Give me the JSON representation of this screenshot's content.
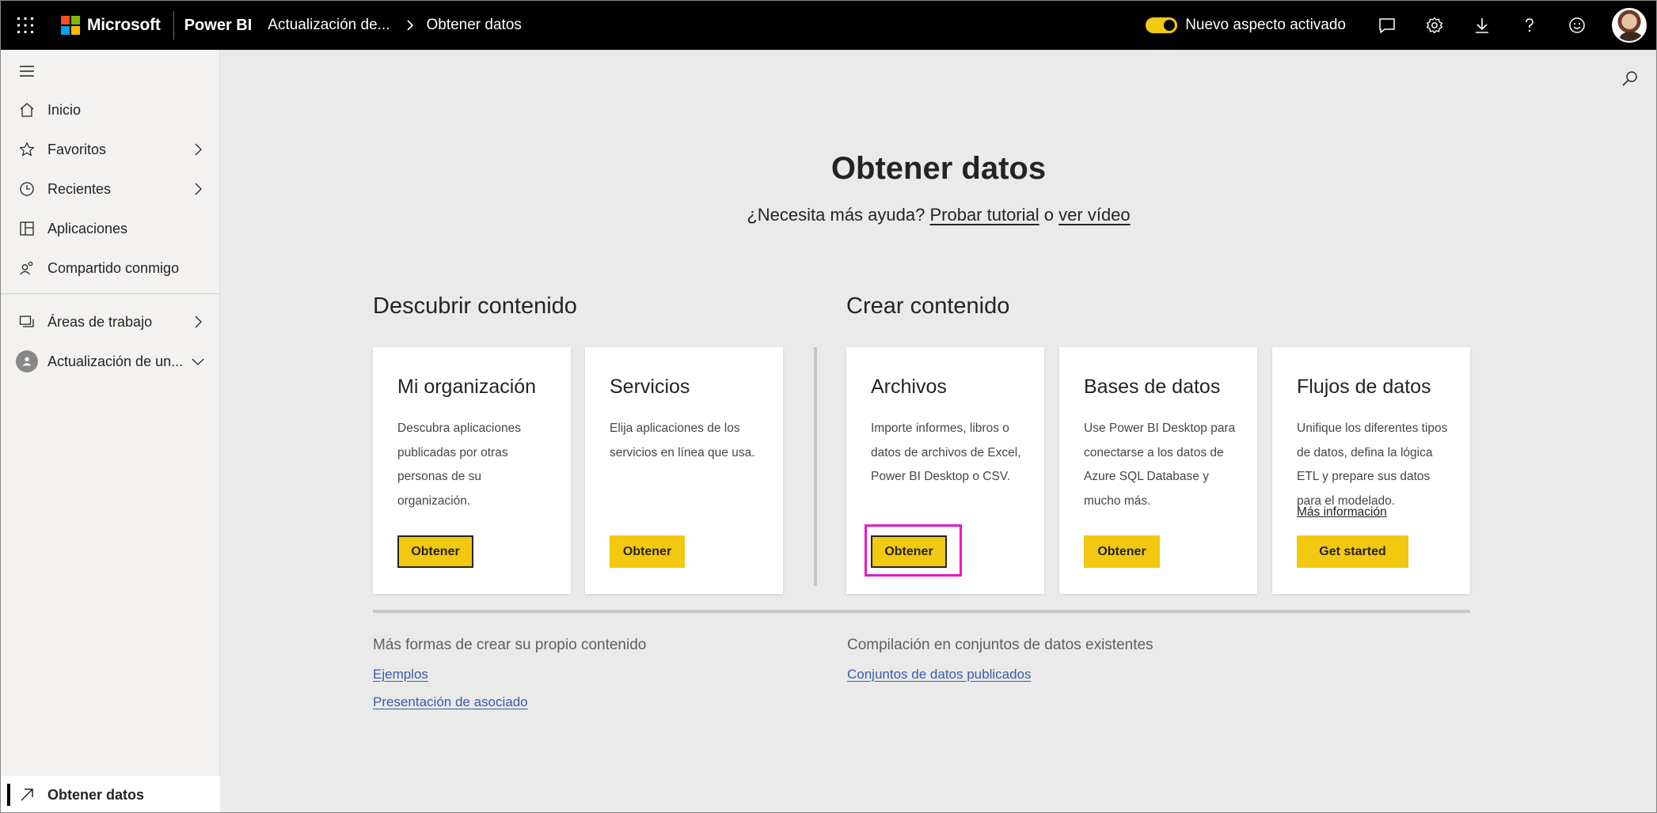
{
  "header": {
    "brand": "Microsoft",
    "product": "Power BI",
    "breadcrumb_workspace": "Actualización de...",
    "breadcrumb_page": "Obtener datos",
    "toggle_label": "Nuevo aspecto activado",
    "brand_colors": [
      "#f25022",
      "#7fba00",
      "#00a4ef",
      "#ffb900"
    ],
    "icons": [
      "waffle-icon",
      "feedback-icon",
      "settings-icon",
      "download-icon",
      "help-icon",
      "smiley-icon"
    ]
  },
  "sidebar": {
    "items": [
      {
        "label": "Inicio",
        "icon": "home-icon"
      },
      {
        "label": "Favoritos",
        "icon": "star-icon"
      },
      {
        "label": "Recientes",
        "icon": "clock-icon"
      },
      {
        "label": "Aplicaciones",
        "icon": "apps-icon"
      },
      {
        "label": "Compartido conmigo",
        "icon": "shared-icon"
      },
      {
        "label": "Áreas de trabajo",
        "icon": "workspaces-icon"
      },
      {
        "label": "Actualización de un...",
        "icon": "workspace-avatar-icon"
      }
    ],
    "bottom_item": "Obtener datos"
  },
  "main": {
    "title": "Obtener datos",
    "help_prefix": "¿Necesita más ayuda?",
    "help_link1": "Probar tutorial",
    "help_or": "o",
    "help_link2": "ver vídeo",
    "discover_heading": "Descubrir contenido",
    "create_heading": "Crear contenido",
    "cards": [
      {
        "title": "Mi organización",
        "description": "Descubra aplicaciones publicadas por otras personas de su organización.",
        "button": "Obtener"
      },
      {
        "title": "Servicios",
        "description": "Elija aplicaciones de los servicios en línea que usa.",
        "button": "Obtener"
      },
      {
        "title": "Archivos",
        "description": "Importe informes, libros o datos de archivos de Excel, Power BI Desktop o CSV.",
        "button": "Obtener"
      },
      {
        "title": "Bases de datos",
        "description": "Use Power BI Desktop para conectarse a los datos de Azure SQL Database y mucho más.",
        "button": "Obtener"
      },
      {
        "title": "Flujos de datos",
        "description": "Unifique los diferentes tipos de datos, defina la lógica ETL y prepare sus datos para el modelado.",
        "more_link": "Más información",
        "button": "Get started"
      }
    ],
    "footer_left_heading": "Más formas de crear su propio contenido",
    "footer_left_links": [
      "Ejemplos",
      "Presentación de asociado"
    ],
    "footer_right_heading": "Compilación en conjuntos de datos existentes",
    "footer_right_links": [
      "Conjuntos de datos publicados"
    ],
    "accent_color": "#f2c811",
    "highlight_color": "#e619c8"
  }
}
